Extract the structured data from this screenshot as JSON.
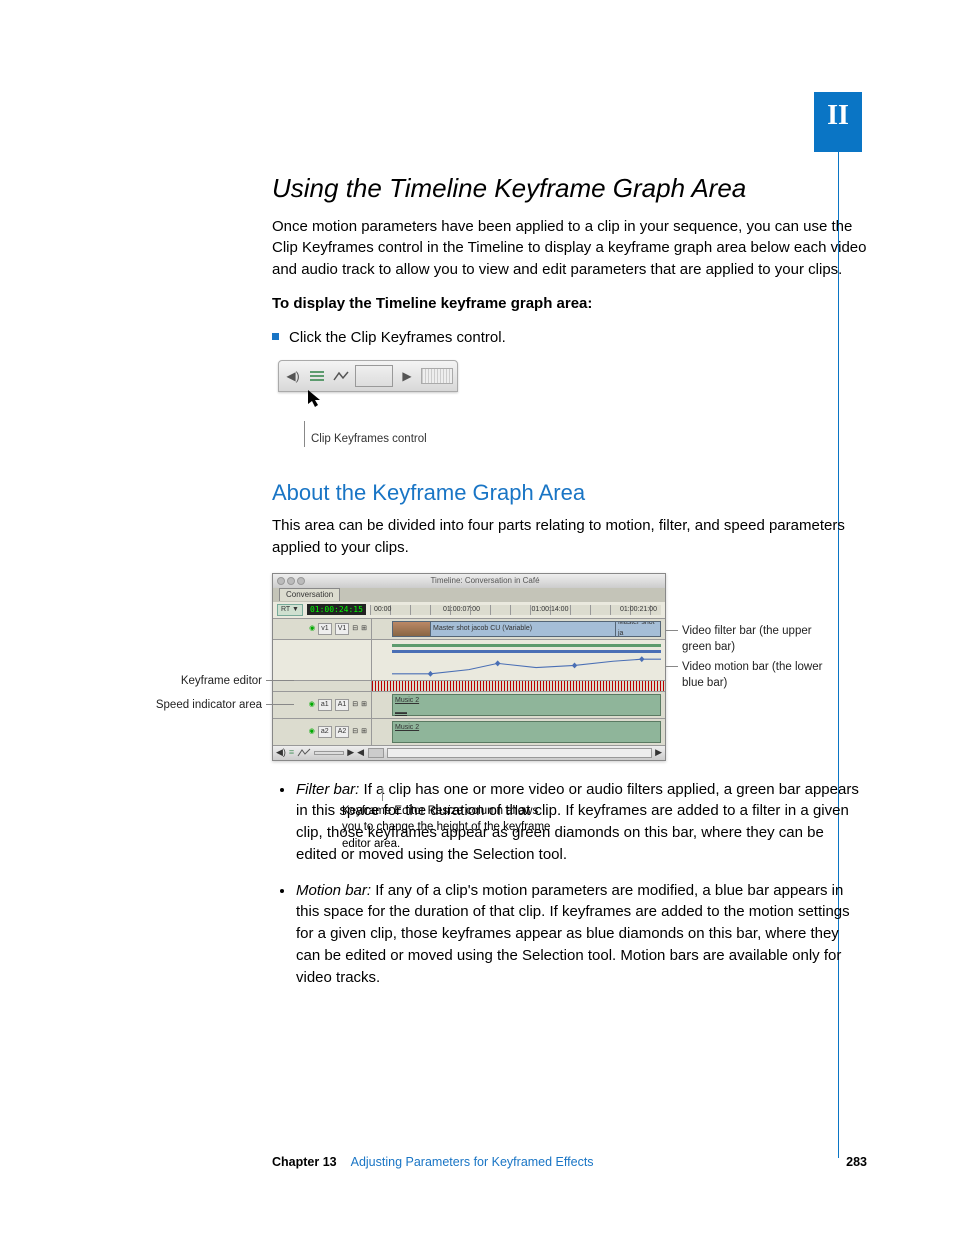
{
  "section_tab": "II",
  "heading1": "Using the Timeline Keyframe Graph Area",
  "intro_para": "Once motion parameters have been applied to a clip in your sequence, you can use the Clip Keyframes control in the Timeline to display a keyframe graph area below each video and audio track to allow you to view and edit parameters that are applied to your clips.",
  "task_heading": "To display the Timeline keyframe graph area:",
  "task_step": "Click the Clip Keyframes control.",
  "fig1_caption": "Clip Keyframes control",
  "heading2": "About the Keyframe Graph Area",
  "about_para": "This area can be divided into four parts relating to motion, filter, and speed parameters applied to your clips.",
  "figure2": {
    "window_title": "Timeline: Conversation in Café",
    "tab": "Conversation",
    "rt": "RT ▼",
    "timecode": "01:00:24:15",
    "ruler_ticks": [
      "00:00",
      "01:00:07:00",
      "01:00:14:00",
      "01:00:21:00"
    ],
    "v_track": {
      "src": "v1",
      "dst": "V1"
    },
    "clip_mid": "Master shot jacob CU (Variable)",
    "clip_end": "Master shot ja",
    "a1": {
      "src": "a1",
      "dst": "A1",
      "clip": "Music 2"
    },
    "a2": {
      "src": "a2",
      "dst": "A2",
      "clip": "Music 2"
    }
  },
  "callouts": {
    "keyframe_editor": "Keyframe editor",
    "speed_indicator": "Speed indicator area",
    "video_filter": "Video filter bar (the upper green bar)",
    "video_motion": "Video motion bar (the lower blue bar)",
    "resize_col": "Keyframe Editor Resize column allows you to change the height of the keyframe editor area."
  },
  "definitions": {
    "filter_term": "Filter bar:",
    "filter_text": "  If a clip has one or more video or audio filters applied, a green bar appears in this space for the duration of that clip. If keyframes are added to a filter in a given clip, those keyframes appear as green diamonds on this bar, where they can be edited or moved using the Selection tool.",
    "motion_term": "Motion bar:",
    "motion_text": "  If any of a clip's motion parameters are modified, a blue bar appears in this space for the duration of that clip. If keyframes are added to the motion settings for a given clip, those keyframes appear as blue diamonds on this bar, where they can be edited or moved using the Selection tool. Motion bars are available only for video tracks."
  },
  "footer": {
    "chapter": "Chapter 13",
    "title": "Adjusting Parameters for Keyframed Effects",
    "page": "283"
  }
}
